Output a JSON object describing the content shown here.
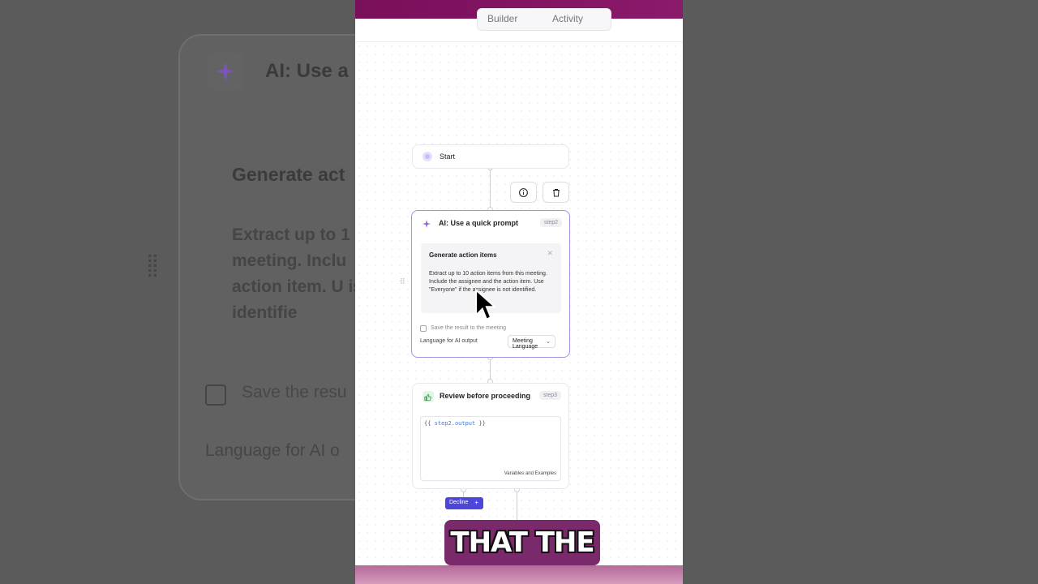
{
  "background": {
    "title": "AI: Use a",
    "heading": "Generate act",
    "body": "Extract up to 1 meeting. Inclu action item. U is not identifie",
    "save": "Save the resu",
    "language": "Language for AI o"
  },
  "tabs": {
    "builder": "Builder",
    "activity": "Activity"
  },
  "start": {
    "label": "Start"
  },
  "ai_step": {
    "title": "AI: Use a quick prompt",
    "badge": "step2",
    "prompt_heading": "Generate action items",
    "prompt_body": "Extract up to 10 action items from this meeting. Include the assignee and the action item. Use \"Everyone\" if the assignee is not identified.",
    "save_label": "Save the result to the meeting",
    "language_label": "Language for AI output",
    "language_value": "Meeting Language"
  },
  "review_step": {
    "title": "Review before proceeding",
    "badge": "step3",
    "code_open": "{{ ",
    "code_var": "step2.output",
    "code_close": " }}",
    "vars_link": "Variables and Examples"
  },
  "decline_label": "Decline",
  "caption": "THAT THE",
  "icon_names": [
    "sparkle-icon",
    "info-icon",
    "trash-icon",
    "thumbs-up-icon",
    "chevron-down-icon",
    "close-icon",
    "drag-handle-icon",
    "cursor-icon"
  ],
  "colors": {
    "accent": "#4e46d9",
    "ai_border": "#9d94e6",
    "topbar": "#7a0f5a"
  }
}
